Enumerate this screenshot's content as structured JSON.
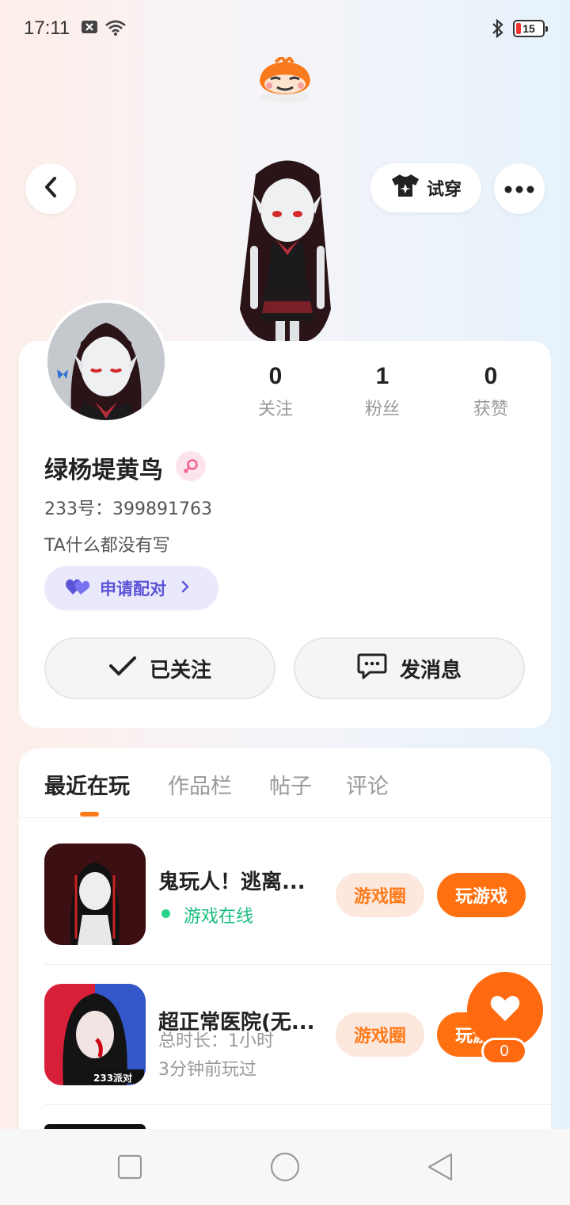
{
  "status_bar": {
    "time": "17:11",
    "battery": "15"
  },
  "header": {
    "try_on_label": "试穿"
  },
  "profile": {
    "nickname": "绿杨堤黄鸟",
    "uid": "233号：399891763",
    "bio": "TA什么都没有写",
    "pair_label": "申请配对",
    "stats": [
      {
        "value": "0",
        "label": "关注"
      },
      {
        "value": "1",
        "label": "粉丝"
      },
      {
        "value": "0",
        "label": "获赞"
      }
    ],
    "follow_label": "已关注",
    "message_label": "发消息"
  },
  "tabs": [
    {
      "label": "最近在玩"
    },
    {
      "label": "作品栏"
    },
    {
      "label": "帖子"
    },
    {
      "label": "评论"
    }
  ],
  "games": [
    {
      "name": "鬼玩人！逃离...",
      "status": "游戏在线",
      "circle_label": "游戏圈",
      "play_label": "玩游戏"
    },
    {
      "name": "超正常医院(无...",
      "duration": "总时长：1小时",
      "last_played": "3分钟前玩过",
      "circle_label": "游戏圈",
      "play_label": "玩游戏",
      "badge": "233派对"
    }
  ],
  "fab": {
    "count": "0"
  },
  "colors": {
    "accent": "#ff7010",
    "online": "#1bbf7f",
    "pair": "#5b54d6"
  }
}
